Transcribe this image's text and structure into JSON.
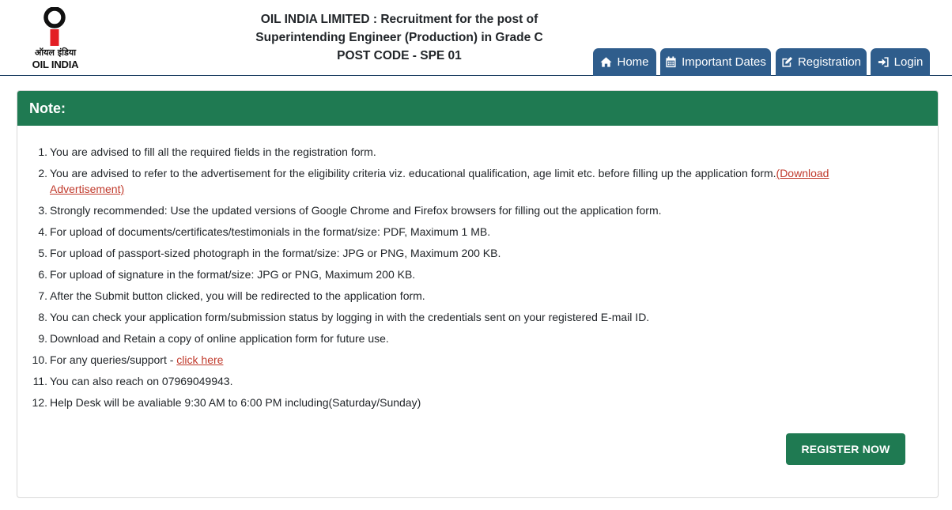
{
  "logo": {
    "hindi_text": "ऑयल इंडिया",
    "english_text": "OIL INDIA"
  },
  "header": {
    "title_line1": "OIL INDIA LIMITED : Recruitment for the post of",
    "title_line2": "Superintending Engineer (Production) in Grade C",
    "title_line3": "POST CODE - SPE 01"
  },
  "nav": {
    "home": {
      "label": "Home",
      "icon": "home-icon"
    },
    "dates": {
      "label": "Important Dates",
      "icon": "calendar-icon"
    },
    "registration": {
      "label": "Registration",
      "icon": "edit-icon"
    },
    "login": {
      "label": "Login",
      "icon": "sign-in-icon"
    }
  },
  "note": {
    "heading": "Note:",
    "items": [
      {
        "num": "1.",
        "text": "You are advised to fill all the required fields in the registration form."
      },
      {
        "num": "2.",
        "text": "You are advised to refer to the advertisement for the eligibility criteria viz. educational qualification, age limit etc. before filling up the application form.",
        "link": "(Download Advertisement)"
      },
      {
        "num": "3.",
        "text": "Strongly recommended: Use the updated versions of Google Chrome and Firefox browsers for filling out the application form."
      },
      {
        "num": "4.",
        "text": "For upload of documents/certificates/testimonials in the format/size: PDF, Maximum 1 MB."
      },
      {
        "num": "5.",
        "text": "For upload of passport-sized photograph in the format/size: JPG or PNG, Maximum 200 KB."
      },
      {
        "num": "6.",
        "text": "For upload of signature in the format/size: JPG or PNG, Maximum 200 KB."
      },
      {
        "num": "7.",
        "text": "After the Submit button clicked, you will be redirected to the application form."
      },
      {
        "num": "8.",
        "text": "You can check your application form/submission status by logging in with the credentials sent on your registered E-mail ID."
      },
      {
        "num": "9.",
        "text": "Download and Retain a copy of online application form for future use."
      },
      {
        "num": "10.",
        "text": "For any queries/support - ",
        "link": "click here"
      },
      {
        "num": "11.",
        "text": "You can also reach on 07969049943."
      },
      {
        "num": "12.",
        "text": "Help Desk will be avaliable 9:30 AM to 6:00 PM including(Saturday/Sunday)"
      }
    ]
  },
  "register_button": "REGISTER NOW",
  "colors": {
    "nav": "#2f5d8c",
    "green": "#1f7a52",
    "link": "#c0392b",
    "logo_red": "#e31e24"
  }
}
